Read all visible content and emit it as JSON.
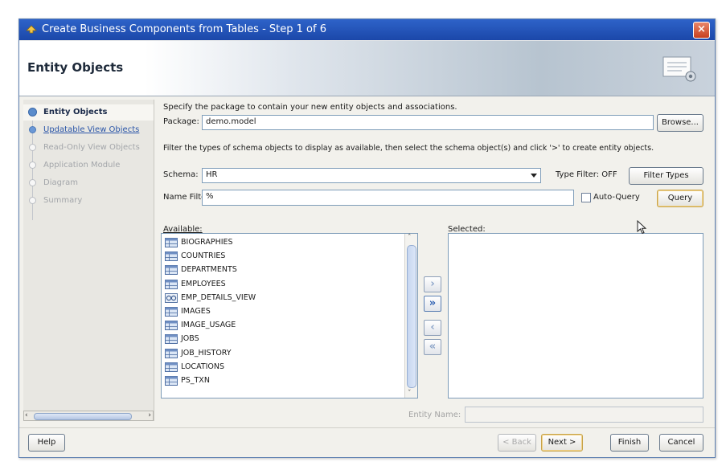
{
  "window": {
    "title": "Create Business Components from Tables - Step 1 of 6",
    "close": "×"
  },
  "banner": {
    "title": "Entity Objects"
  },
  "nav": {
    "items": [
      {
        "label": "Entity Objects",
        "state": "active"
      },
      {
        "label": "Updatable View Objects",
        "state": "link"
      },
      {
        "label": "Read-Only View Objects",
        "state": "disabled"
      },
      {
        "label": "Application Module",
        "state": "disabled"
      },
      {
        "label": "Diagram",
        "state": "disabled"
      },
      {
        "label": "Summary",
        "state": "disabled"
      }
    ]
  },
  "form": {
    "intro": "Specify the package to contain your new entity objects and associations.",
    "package_label": "Package:",
    "package_value": "demo.model",
    "browse_label": "Browse...",
    "filter_hint": "Filter the types of schema objects to display as available, then select the schema object(s) and click '>' to create entity objects.",
    "schema_label": "Schema:",
    "schema_value": "HR",
    "type_filter_label": "Type Filter: OFF",
    "filter_types_label": "Filter Types",
    "name_filter_label": "Name Filter:",
    "name_filter_value": "%",
    "auto_query_label": "Auto-Query",
    "auto_query_checked": false,
    "query_label": "Query",
    "available_label": "Available:",
    "selected_label": "Selected:",
    "entity_name_label": "Entity Name:",
    "entity_name_value": ""
  },
  "available": [
    {
      "name": "BIOGRAPHIES",
      "kind": "table"
    },
    {
      "name": "COUNTRIES",
      "kind": "table"
    },
    {
      "name": "DEPARTMENTS",
      "kind": "table"
    },
    {
      "name": "EMPLOYEES",
      "kind": "table"
    },
    {
      "name": "EMP_DETAILS_VIEW",
      "kind": "view"
    },
    {
      "name": "IMAGES",
      "kind": "table"
    },
    {
      "name": "IMAGE_USAGE",
      "kind": "table"
    },
    {
      "name": "JOBS",
      "kind": "table"
    },
    {
      "name": "JOB_HISTORY",
      "kind": "table"
    },
    {
      "name": "LOCATIONS",
      "kind": "table"
    },
    {
      "name": "PS_TXN",
      "kind": "table"
    }
  ],
  "shuttle": {
    "add": "›",
    "add_all": "»",
    "remove": "‹",
    "remove_all": "«"
  },
  "footer": {
    "help": "Help",
    "back": "< Back",
    "next": "Next >",
    "finish": "Finish",
    "cancel": "Cancel"
  },
  "colors": {
    "title_bar": "#1b47a9",
    "link": "#2b56a8",
    "focus": "#c7a34a"
  }
}
